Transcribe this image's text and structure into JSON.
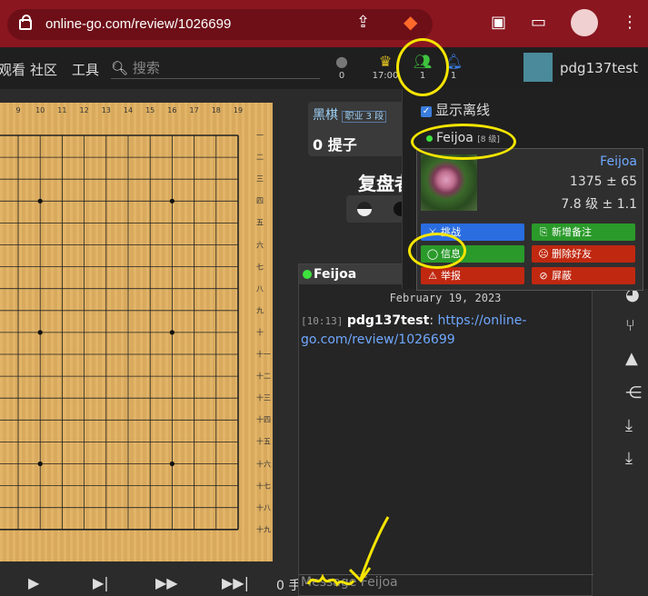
{
  "browser": {
    "url": "online-go.com/review/1026699"
  },
  "site_nav": {
    "items": [
      "观看",
      "社区",
      "工具"
    ],
    "search_placeholder": "搜索",
    "stats": [
      {
        "icon": "chat-icon",
        "value": "0"
      },
      {
        "icon": "trophy-icon",
        "value": "17:00"
      },
      {
        "icon": "friends-icon",
        "value": "1"
      },
      {
        "icon": "bell-icon",
        "value": "1"
      }
    ],
    "username": "pdg137test"
  },
  "board": {
    "col_labels": [
      "9",
      "10",
      "11",
      "12",
      "13",
      "14",
      "15",
      "16",
      "17",
      "18",
      "19"
    ],
    "row_labels": [
      "一",
      "二",
      "三",
      "四",
      "五",
      "六",
      "七",
      "八",
      "九",
      "十",
      "十一",
      "十二",
      "十三",
      "十四",
      "十五",
      "十六",
      "十七",
      "十八",
      "十九"
    ]
  },
  "black_player": {
    "name": "黑棋",
    "rank": "职业 3 段",
    "captures": "0 提子"
  },
  "review_title": "复盘者",
  "controls": {
    "move_count": "0 手"
  },
  "dropdown": {
    "show_offline_label": "显示离线",
    "friend_name": "Feijoa",
    "friend_rank": "[8 级]"
  },
  "user_card": {
    "name": "Feijoa",
    "rating": "1375 ± 65",
    "rank": "7.8 级 ± 1.1",
    "buttons": [
      {
        "label": "挑战",
        "icon": "challenge-icon",
        "color": "#2a6de0"
      },
      {
        "label": "新增备注",
        "icon": "note-icon",
        "color": "#2a9a2a"
      },
      {
        "label": "信息",
        "icon": "message-icon",
        "color": "#2a9a2a"
      },
      {
        "label": "删除好友",
        "icon": "remove-friend-icon",
        "color": "#c02810"
      },
      {
        "label": "举报",
        "icon": "report-icon",
        "color": "#c02810"
      },
      {
        "label": "屏蔽",
        "icon": "block-icon",
        "color": "#c02810"
      }
    ]
  },
  "chat": {
    "title": "Feijoa",
    "date": "February 19, 2023",
    "message_time": "[10:13]",
    "message_author": "pdg137test",
    "message_link": "https://online-go.com/review/1026699",
    "input_placeholder": "Message Feijoa"
  }
}
